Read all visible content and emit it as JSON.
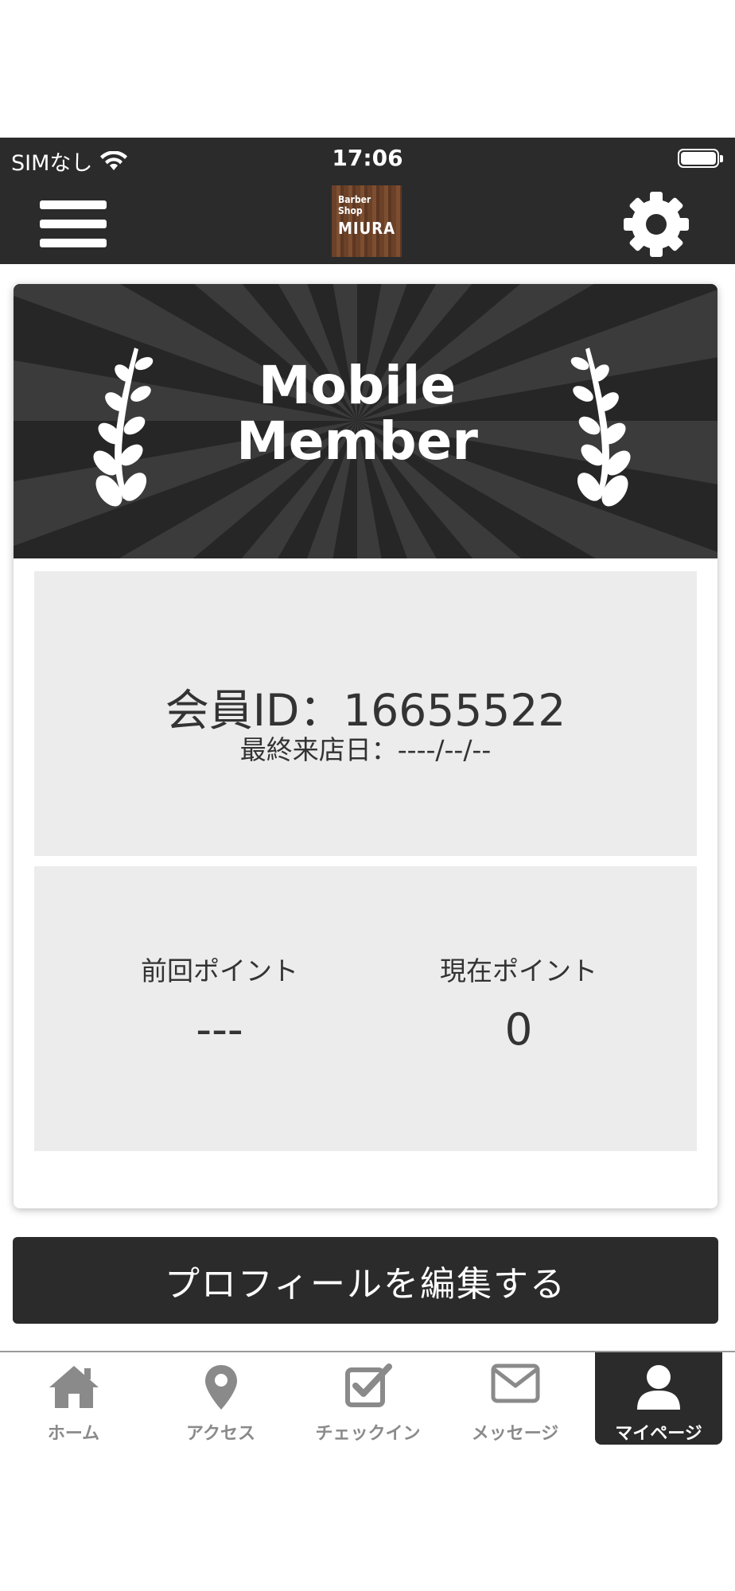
{
  "status_bar": {
    "carrier": "SIMなし",
    "time": "17:06"
  },
  "header": {
    "menu_icon": "hamburger-menu-icon",
    "logo": {
      "line1": "Barber",
      "line2": "Shop",
      "line3": "MIURA"
    },
    "settings_icon": "gear-icon"
  },
  "banner": {
    "title_line1": "Mobile",
    "title_line2": "Member",
    "decoration_icon": "laurel-branch-icon"
  },
  "member": {
    "id_text": "会員ID：16655522",
    "last_visit_text": "最終来店日：----/--/--"
  },
  "points": {
    "previous_label": "前回ポイント",
    "previous_value": "---",
    "current_label": "現在ポイント",
    "current_value": "0"
  },
  "edit_profile_label": "プロフィールを編集する",
  "tabs": [
    {
      "label": "ホーム",
      "icon": "home-icon"
    },
    {
      "label": "アクセス",
      "icon": "map-pin-icon"
    },
    {
      "label": "チェックイン",
      "icon": "checkbox-icon"
    },
    {
      "label": "メッセージ",
      "icon": "envelope-icon"
    },
    {
      "label": "マイページ",
      "icon": "user-icon",
      "active": true
    }
  ],
  "colors": {
    "dark": "#2b2b2b",
    "panel": "#ececec",
    "inactive_tab": "#8a8a8a",
    "text": "#333333"
  }
}
